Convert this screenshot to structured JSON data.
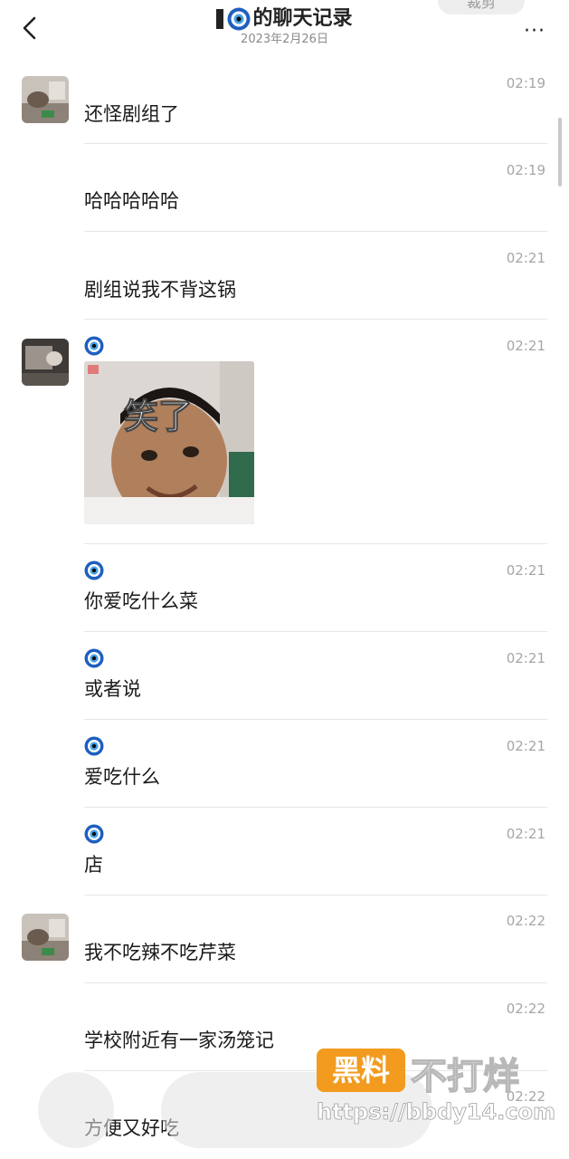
{
  "header": {
    "title": "的聊天记录",
    "date": "2023年2月26日",
    "more_label": "···",
    "ghost_button_label": "裁剪"
  },
  "messages": [
    {
      "time": "02:19",
      "text": "还怪剧组了",
      "avatar": "user-photo-1"
    },
    {
      "time": "02:19",
      "text": "哈哈哈哈哈"
    },
    {
      "time": "02:21",
      "text": "剧组说我不背这锅"
    },
    {
      "time": "02:21",
      "sticker_caption": "笑了",
      "avatar": "user-photo-2"
    },
    {
      "time": "02:21",
      "text": "你爱吃什么菜"
    },
    {
      "time": "02:21",
      "text": "或者说"
    },
    {
      "time": "02:21",
      "text": "爱吃什么"
    },
    {
      "time": "02:21",
      "text": "店"
    },
    {
      "time": "02:22",
      "text": "我不吃辣不吃芹菜",
      "avatar": "user-photo-1"
    },
    {
      "time": "02:22",
      "text": "学校附近有一家汤笼记"
    },
    {
      "time": "02:22",
      "text": "方便又好吃"
    }
  ],
  "watermark": {
    "badge": "黑料",
    "text": "不打烊",
    "url": "https://bbdy14.com"
  },
  "icons": {
    "back": "chevron-left-icon",
    "more": "more-dots-icon",
    "evil-eye": "evil-eye-icon"
  },
  "colors": {
    "background": "#ffffff",
    "time": "#a6a6a6",
    "divider": "#e6e6e6",
    "watermark_badge": "#f29b1f",
    "evil_eye_blue": "#1f5fbf"
  }
}
